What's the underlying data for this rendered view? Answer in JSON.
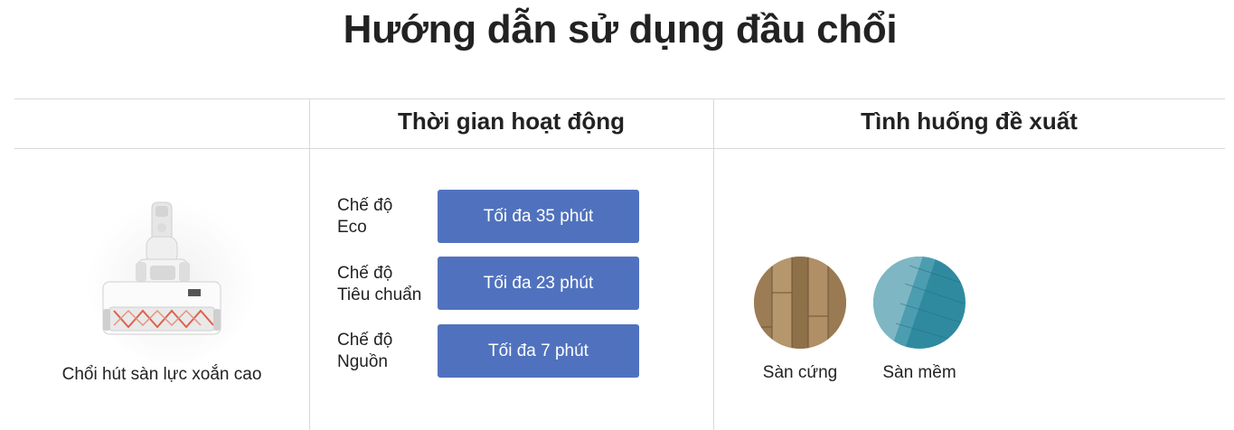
{
  "page": {
    "title": "Hướng dẫn sử dụng đầu chổi"
  },
  "table": {
    "headers": [
      "",
      "Thời gian hoạt động",
      "Tình huống đề xuất"
    ],
    "product": {
      "name": "Chổi hút sàn lực xoắn cao",
      "image": "brush-head-image"
    },
    "modes": [
      {
        "label_line1": "Chế độ",
        "label_line2": "Eco",
        "time": "Tối đa 35 phút"
      },
      {
        "label_line1": "Chế độ",
        "label_line2": "Tiêu chuẩn",
        "time": "Tối đa 23 phút"
      },
      {
        "label_line1": "Chế độ",
        "label_line2": "Nguồn",
        "time": "Tối đa 7 phút"
      }
    ],
    "surfaces": [
      {
        "label": "Sàn cứng",
        "image": "hardwood-floor-image"
      },
      {
        "label": "Sàn mềm",
        "image": "carpet-image"
      }
    ]
  },
  "colors": {
    "button": "#5072be",
    "button_text": "#ffffff",
    "divider": "#d9d9d9",
    "text": "#222222"
  }
}
